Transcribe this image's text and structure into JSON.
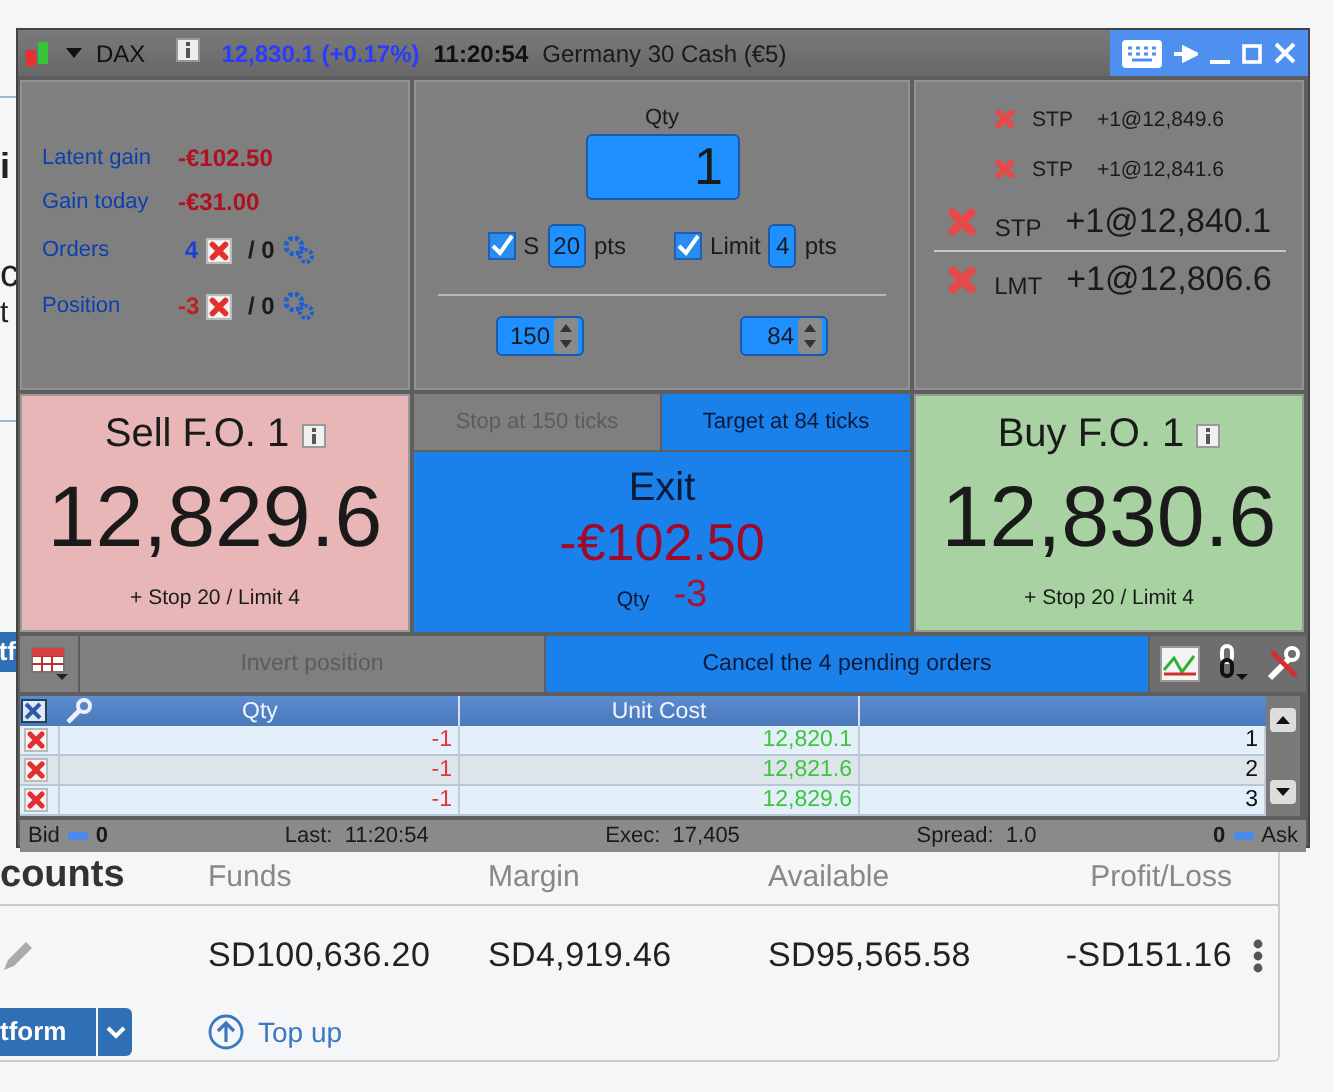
{
  "title_bar": {
    "symbol": "DAX",
    "price": "12,830.1 (+0.17%)",
    "time": "11:20:54",
    "instrument": "Germany 30 Cash (€5)"
  },
  "stats": [
    {
      "kind": "money",
      "label": "Latent gain",
      "value": "-€102.50"
    },
    {
      "kind": "money",
      "label": "Gain today",
      "value": "-€31.00"
    },
    {
      "kind": "count",
      "label": "Orders",
      "value": "4",
      "color": "#1b3fd8",
      "other": "/ 0"
    },
    {
      "kind": "count",
      "label": "Position",
      "value": "-3",
      "color": "#c02020",
      "other": "/ 0"
    }
  ],
  "order_form": {
    "qty_label": "Qty",
    "qty": "1",
    "stop": {
      "label": "S",
      "checked": true,
      "value": "20",
      "unit": "pts"
    },
    "limit": {
      "label": "Limit",
      "checked": true,
      "value": "4",
      "unit": "pts"
    },
    "stop_ticks": "150",
    "target_ticks": "84"
  },
  "pending_orders": [
    {
      "kind": "small",
      "type": "STP",
      "order": "+1@12,849.6"
    },
    {
      "kind": "small",
      "type": "STP",
      "order": "+1@12,841.6"
    },
    {
      "kind": "large",
      "type": "STP",
      "order": "+1@12,840.1"
    },
    {
      "kind": "large",
      "type": "LMT",
      "order": "+1@12,806.6"
    }
  ],
  "sell": {
    "label": "Sell F.O. 1",
    "price": "12,829.6",
    "note": "+ Stop 20 / Limit 4"
  },
  "buy": {
    "label": "Buy F.O. 1",
    "price": "12,830.6",
    "note": "+ Stop 20 / Limit 4"
  },
  "exit": {
    "stop_button": {
      "label": "Stop at 150 ticks",
      "disabled": true
    },
    "target_button": {
      "label": "Target at 84 ticks",
      "disabled": false
    },
    "label": "Exit",
    "amount": "-€102.50",
    "qty_label": "Qty",
    "qty": "-3"
  },
  "actions": {
    "invert": {
      "label": "Invert position",
      "disabled": true
    },
    "cancel": {
      "label": "Cancel the 4 pending orders",
      "disabled": false
    }
  },
  "table": {
    "columns": [
      "Qty",
      "Unit Cost"
    ],
    "rows": [
      {
        "qty": "-1",
        "cost": "12,820.1",
        "index": "1"
      },
      {
        "qty": "-1",
        "cost": "12,821.6",
        "index": "2"
      },
      {
        "qty": "-1",
        "cost": "12,829.6",
        "index": "3"
      }
    ]
  },
  "status_bar": {
    "bid_label": "Bid",
    "bid": "0",
    "last": "Last:  11:20:54",
    "exec": "Exec:  17,405",
    "spread": "Spread:  1.0",
    "ask": "0",
    "ask_label": "Ask"
  },
  "accounts": {
    "heading": "counts",
    "columns": [
      "Funds",
      "Margin",
      "Available",
      "Profit/Loss"
    ],
    "values": [
      "SD100,636.20",
      "SD4,919.46",
      "SD95,565.58",
      "-SD151.16"
    ],
    "platform_button": "tform",
    "top_up": "Top up"
  },
  "bg_fragments": [
    "i",
    "c",
    "t",
    "tf"
  ]
}
